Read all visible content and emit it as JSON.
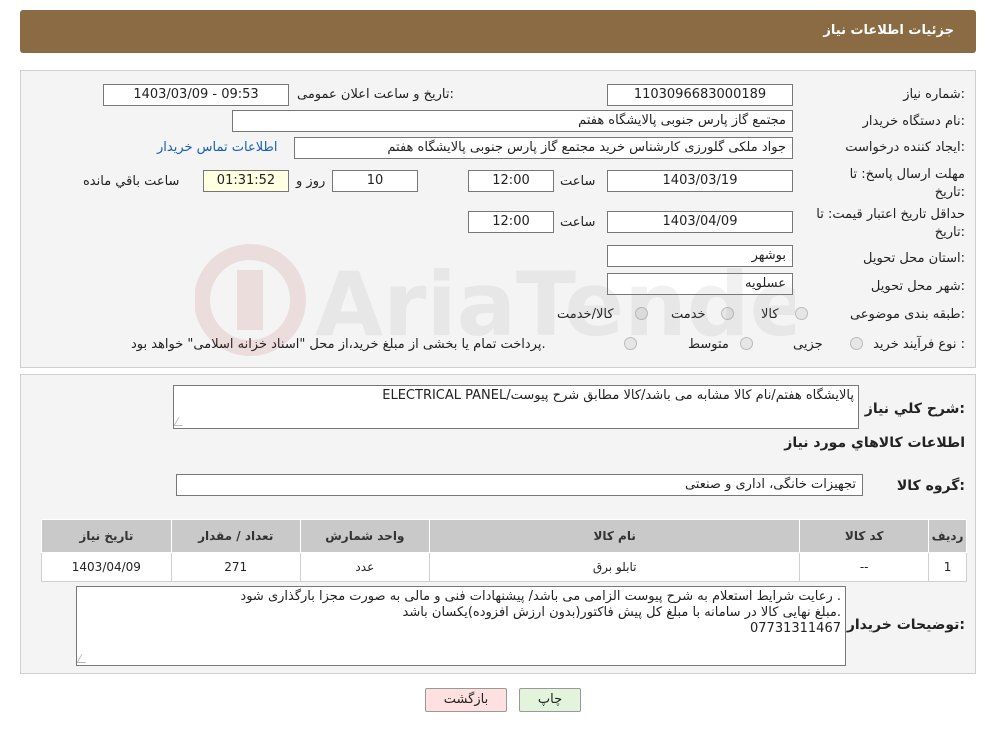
{
  "header": {
    "title": "جزئیات اطلاعات نیاز"
  },
  "form": {
    "need_number_label": "شماره نیاز:",
    "need_number": "1103096683000189",
    "announce_label": "تاریخ و ساعت اعلان عمومی:",
    "announce_value": "1403/03/09 - 09:53",
    "buyer_org_label": "نام دستگاه خریدار:",
    "buyer_org": "مجتمع گاز پارس جنوبی  پالایشگاه هفتم",
    "creator_label": "ایجاد کننده درخواست:",
    "creator": "جواد ملکی گلورزی کارشناس خرید مجتمع گاز پارس جنوبی  پالایشگاه هفتم",
    "contact_link": "اطلاعات تماس خریدار",
    "deadline_label": "مهلت ارسال پاسخ: تا تاریخ:",
    "deadline_date": "1403/03/19",
    "time_label": "ساعت",
    "deadline_time": "12:00",
    "days_value": "10",
    "days_label": "روز و",
    "remaining_time": "01:31:52",
    "remaining_label": "ساعت باقي مانده",
    "validity_label": "حداقل تاریخ اعتبار قیمت: تا تاریخ:",
    "validity_date": "1403/04/09",
    "validity_time": "12:00",
    "province_label": "استان محل تحویل:",
    "province": "بوشهر",
    "city_label": "شهر محل تحویل:",
    "city": "عسلویه",
    "category_label": "طبقه بندی موضوعی:",
    "category_options": [
      "کالا",
      "خدمت",
      "کالا/خدمت"
    ],
    "process_label": "نوع فرآیند خرید :",
    "process_options": [
      "جزیی",
      "متوسط"
    ],
    "process_note": "پرداخت تمام یا بخشی از مبلغ خرید،از محل \"اسناد خزانه اسلامی\" خواهد بود."
  },
  "details": {
    "desc_label": "شرح کلي نياز:",
    "desc_value": "ELECTRICAL PANEL/پالایشگاه هفتم/نام کالا مشابه می باشد/کالا مطابق شرح پیوست",
    "items_heading": "اطلاعات کالاهاي مورد نياز",
    "group_label": "گروه کالا:",
    "group_value": "تجهیزات خانگی، اداری و صنعتی",
    "table": {
      "headers": [
        "رديف",
        "کد کالا",
        "نام کالا",
        "واحد شمارش",
        "تعداد / مقدار",
        "تاریخ نیاز"
      ],
      "rows": [
        [
          "1",
          "--",
          "تابلو برق",
          "عدد",
          "271",
          "1403/04/09"
        ]
      ]
    },
    "buyer_notes_label": "توضیحات خریدار:",
    "buyer_notes": [
      "رعایت شرایط استعلام به شرح پیوست الزامی می باشد/ پیشنهادات فنی و مالی به صورت مجزا بارگذاری شود .",
      "مبلغ نهایی کالا در سامانه با مبلغ کل پیش فاکتور(بدون ارزش افزوده)یکسان باشد.",
      "07731311467"
    ]
  },
  "buttons": {
    "print": "چاپ",
    "back": "بازگشت"
  },
  "watermark": "AriaTender.neT",
  "colors": {
    "header_bg": "#8b6b44",
    "link": "#1a5fb4",
    "remaining_bg": "#ffffe2",
    "back_btn_bg": "#ffe0e0",
    "print_btn_bg": "#e2f5dc"
  }
}
